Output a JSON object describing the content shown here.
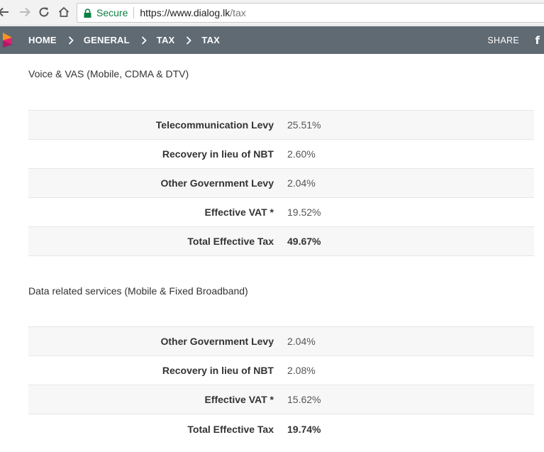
{
  "browser": {
    "secure_label": "Secure",
    "url_host": "https://www.dialog.lk",
    "url_path": "/tax"
  },
  "header": {
    "breadcrumbs": [
      "HOME",
      "GENERAL",
      "TAX",
      "TAX"
    ],
    "share_label": "SHARE",
    "facebook_glyph": "f",
    "colors": {
      "bar": "#5f6a73",
      "logo_orange": "#f7941d",
      "logo_magenta": "#e0206e"
    }
  },
  "sections": [
    {
      "title": "Voice & VAS (Mobile, CDMA & DTV)",
      "rows": [
        {
          "label": "Telecommunication Levy",
          "value": "25.51%"
        },
        {
          "label": "Recovery in lieu of NBT",
          "value": "2.60%"
        },
        {
          "label": "Other Government Levy",
          "value": "2.04%"
        },
        {
          "label": "Effective VAT *",
          "value": "19.52%"
        },
        {
          "label": "Total Effective Tax",
          "value": "49.67%"
        }
      ]
    },
    {
      "title": "Data related services (Mobile & Fixed Broadband)",
      "rows": [
        {
          "label": "Other Government Levy",
          "value": "2.04%"
        },
        {
          "label": "Recovery in lieu of NBT",
          "value": "2.08%"
        },
        {
          "label": "Effective VAT *",
          "value": "15.62%"
        },
        {
          "label": "Total Effective Tax",
          "value": "19.74%"
        }
      ]
    }
  ]
}
